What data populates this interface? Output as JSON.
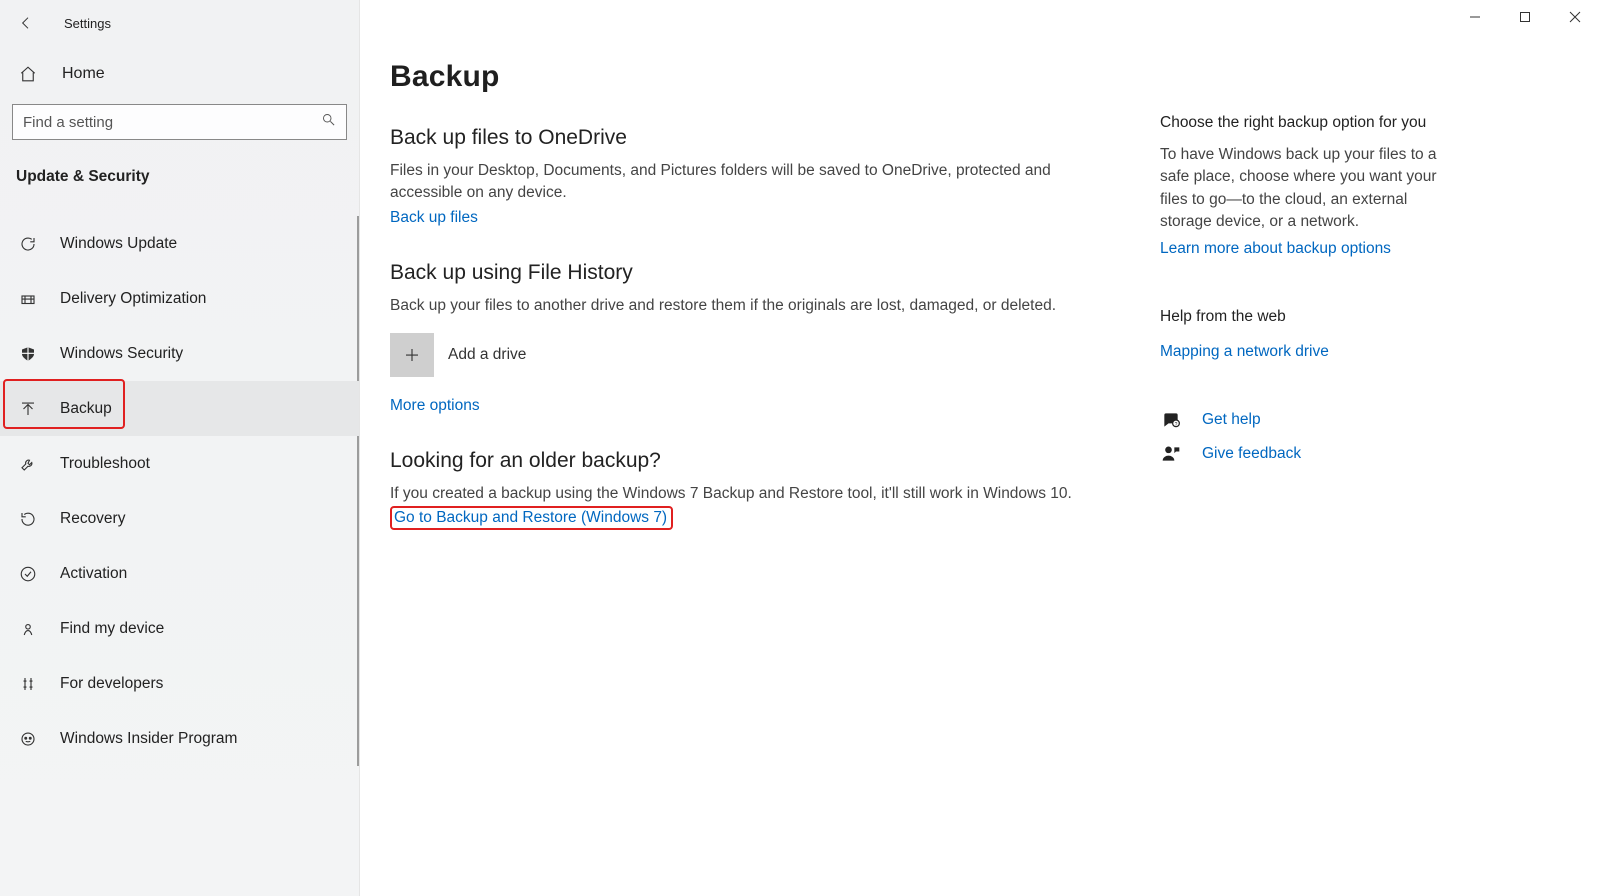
{
  "window": {
    "title": "Settings"
  },
  "sidebar": {
    "home_label": "Home",
    "search_placeholder": "Find a setting",
    "category": "Update & Security",
    "items": [
      {
        "icon": "refresh-icon",
        "label": "Windows Update"
      },
      {
        "icon": "delivery-icon",
        "label": "Delivery Optimization"
      },
      {
        "icon": "shield-icon",
        "label": "Windows Security"
      },
      {
        "icon": "backup-icon",
        "label": "Backup"
      },
      {
        "icon": "wrench-icon",
        "label": "Troubleshoot"
      },
      {
        "icon": "recovery-icon",
        "label": "Recovery"
      },
      {
        "icon": "check-icon",
        "label": "Activation"
      },
      {
        "icon": "locate-icon",
        "label": "Find my device"
      },
      {
        "icon": "devtools-icon",
        "label": "For developers"
      },
      {
        "icon": "insider-icon",
        "label": "Windows Insider Program"
      }
    ],
    "selected_index": 3
  },
  "main": {
    "title": "Backup",
    "onedrive": {
      "heading": "Back up files to OneDrive",
      "body": "Files in your Desktop, Documents, and Pictures folders will be saved to OneDrive, protected and accessible on any device.",
      "link": "Back up files"
    },
    "file_history": {
      "heading": "Back up using File History",
      "body": "Back up your files to another drive and restore them if the originals are lost, damaged, or deleted.",
      "add_label": "Add a drive",
      "more_link": "More options"
    },
    "older": {
      "heading": "Looking for an older backup?",
      "body": "If you created a backup using the Windows 7 Backup and Restore tool, it'll still work in Windows 10.",
      "link": "Go to Backup and Restore (Windows 7)"
    }
  },
  "right": {
    "choose": {
      "heading": "Choose the right backup option for you",
      "body": "To have Windows back up your files to a safe place, choose where you want your files to go—to the cloud, an external storage device, or a network.",
      "link": "Learn more about backup options"
    },
    "help_heading": "Help from the web",
    "help_link": "Mapping a network drive",
    "get_help": "Get help",
    "feedback": "Give feedback"
  }
}
